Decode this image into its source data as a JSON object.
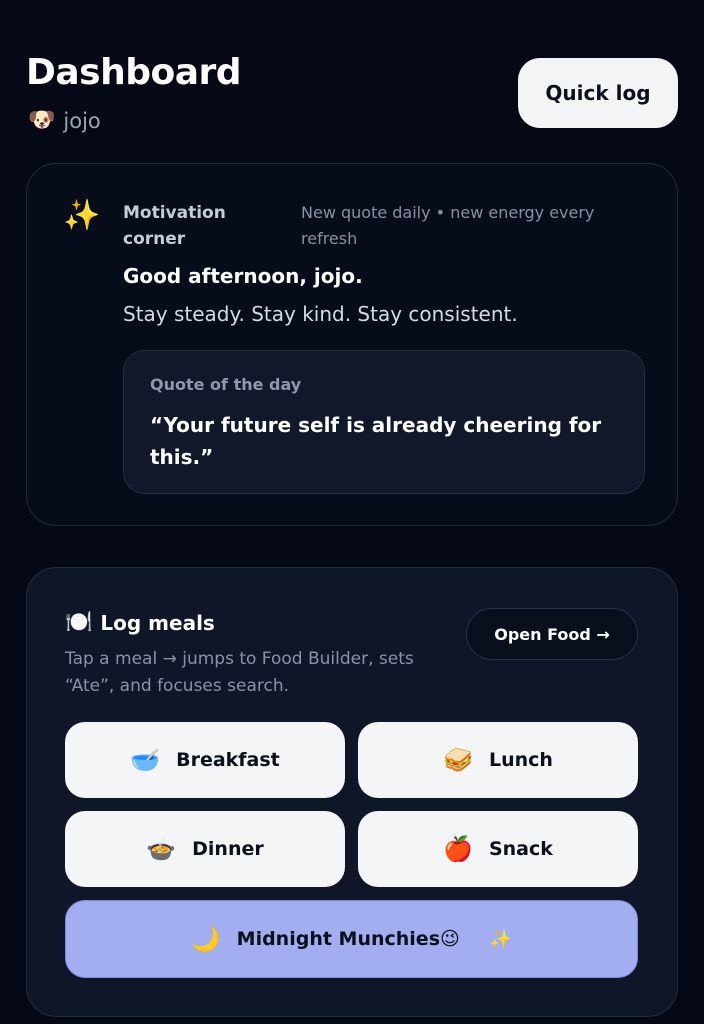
{
  "header": {
    "title": "Dashboard",
    "user_avatar": "🐶",
    "user_name": "jojo",
    "quick_log_label": "Quick log"
  },
  "motivation": {
    "icon": "✨",
    "label": "Motivation corner",
    "subtitle": "New quote daily • new energy every refresh",
    "greeting": "Good afternoon, jojo.",
    "message": "Stay steady. Stay kind. Stay consistent.",
    "quote_label": "Quote of the day",
    "quote": "“Your future self is already cheering for this.”"
  },
  "meals": {
    "icon": "🍽️",
    "title": "Log meals",
    "description": "Tap a meal → jumps to Food Builder, sets “Ate”, and focuses search.",
    "open_food_label": "Open Food →",
    "buttons": [
      {
        "emoji": "🥣",
        "label": "Breakfast"
      },
      {
        "emoji": "🥪",
        "label": "Lunch"
      },
      {
        "emoji": "🍲",
        "label": "Dinner"
      },
      {
        "emoji": "🍎",
        "label": "Snack"
      },
      {
        "emoji": "🌙",
        "label": "Midnight Munchies😉",
        "extra": "✨"
      }
    ]
  },
  "colors": {
    "background": "#050915",
    "button_light": "#f4f5f7",
    "midnight_accent": "#a2aef0"
  }
}
